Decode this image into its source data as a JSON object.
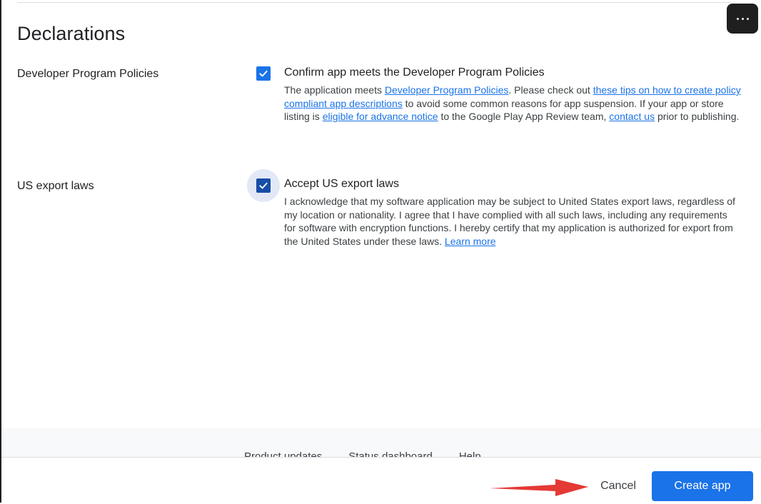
{
  "page": {
    "title": "Declarations",
    "more_menu_icon": "more-horizontal-icon"
  },
  "policies": {
    "label": "Developer Program Policies",
    "checked": true,
    "checkbox_title": "Confirm app meets the Developer Program Policies",
    "desc_1": "The application meets ",
    "link_policies": "Developer Program Policies",
    "desc_2": ". Please check out ",
    "link_tips": "these tips on how to create policy compliant app descriptions",
    "desc_3": " to avoid some common reasons for app suspension. If your app or store listing is ",
    "link_notice": "eligible for advance notice",
    "desc_4": " to the Google Play App Review team, ",
    "link_contact": "contact us",
    "desc_5": " prior to publishing."
  },
  "export": {
    "label": "US export laws",
    "checked": true,
    "checkbox_title": "Accept US export laws",
    "desc": "I acknowledge that my software application may be subject to United States export laws, regardless of my location or nationality. I agree that I have complied with all such laws, including any requirements for software with encryption functions. I hereby certify that my application is authorized for export from the United States under these laws. ",
    "link_learn": "Learn more"
  },
  "footer": {
    "links": [
      "Product updates",
      "Status dashboard",
      "Help"
    ]
  },
  "actions": {
    "cancel_label": "Cancel",
    "create_label": "Create app"
  },
  "colors": {
    "accent": "#1a73e8",
    "annotation_arrow": "#e53935"
  }
}
